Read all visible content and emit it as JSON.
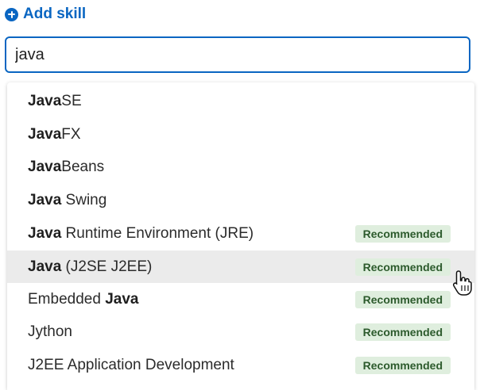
{
  "header": {
    "add_skill_label": "Add skill",
    "add_icon": "plus-circle-icon",
    "accent_color": "#0a66c2"
  },
  "search": {
    "value": "java",
    "placeholder": ""
  },
  "suggestions": [
    {
      "match": "Java",
      "rest": "SE",
      "recommended": false
    },
    {
      "match": "Java",
      "rest": "FX",
      "recommended": false
    },
    {
      "match": "Java",
      "rest": "Beans",
      "recommended": false
    },
    {
      "match": "Java",
      "rest": " Swing",
      "recommended": false
    },
    {
      "match": "Java",
      "rest": " Runtime Environment (JRE)",
      "recommended": true
    },
    {
      "match": "Java",
      "rest": " (J2SE J2EE)",
      "recommended": true,
      "highlighted": true
    },
    {
      "prefix": "Embedded ",
      "match": "Java",
      "rest": "",
      "recommended": true
    },
    {
      "prefix": "Jython",
      "match": "",
      "rest": "",
      "recommended": true
    },
    {
      "prefix": "J2EE Application Development",
      "match": "",
      "rest": "",
      "recommended": true
    }
  ],
  "badge_label": "Recommended",
  "badge_color": "#dfeede",
  "pointer_icon": "hand-pointer-icon"
}
